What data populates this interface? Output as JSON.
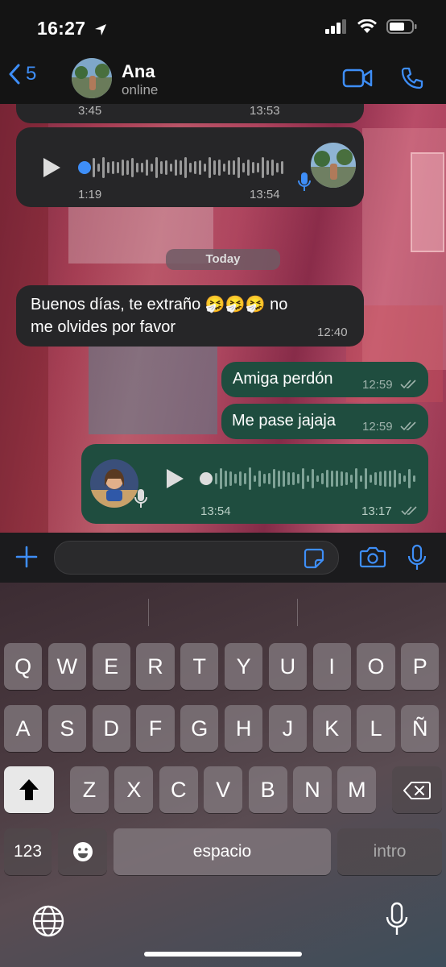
{
  "status_bar": {
    "time": "16:27"
  },
  "header": {
    "back_count": "5",
    "contact_name": "Ana",
    "contact_status": "online"
  },
  "chat": {
    "partial_bubble": {
      "left_time": "3:45",
      "right_time": "13:53"
    },
    "voice_in": {
      "duration": "1:19",
      "time": "13:54"
    },
    "date_separator": "Today",
    "incoming_text": {
      "text": "Buenos días, te extraño 🤧🤧🤧 no me olvides por favor",
      "line1": "Buenos días, te extraño",
      "emojis": "🤧🤧🤧",
      "line1_end": "no",
      "line2": "me olvides por favor",
      "time": "12:40"
    },
    "outgoing_1": {
      "text": "Amiga perdón",
      "time": "12:59"
    },
    "outgoing_2": {
      "text": "Me pase jajaja",
      "time": "12:59"
    },
    "voice_out": {
      "duration": "13:54",
      "time": "13:17"
    }
  },
  "input": {
    "placeholder": ""
  },
  "keyboard": {
    "row1": [
      "Q",
      "W",
      "E",
      "R",
      "T",
      "Y",
      "U",
      "I",
      "O",
      "P"
    ],
    "row2": [
      "A",
      "S",
      "D",
      "F",
      "G",
      "H",
      "J",
      "K",
      "L",
      "Ñ"
    ],
    "row3": [
      "Z",
      "X",
      "C",
      "V",
      "B",
      "N",
      "M"
    ],
    "numbers_key": "123",
    "space_key": "espacio",
    "return_key": "intro"
  },
  "colors": {
    "accent": "#3e8ef7",
    "incoming_bubble": "#262628",
    "outgoing_bubble": "#1f4d3f"
  }
}
